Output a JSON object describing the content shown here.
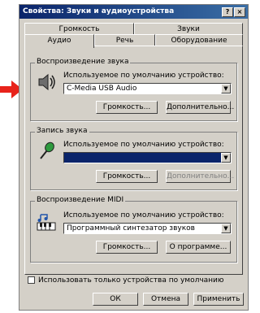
{
  "window": {
    "title": "Свойства: Звуки и аудиоустройства",
    "help_button": "?",
    "close_button": "×"
  },
  "tabs_row1": [
    {
      "label": "Громкость"
    },
    {
      "label": "Звуки"
    }
  ],
  "tabs_row2": [
    {
      "label": "Аудио"
    },
    {
      "label": "Речь"
    },
    {
      "label": "Оборудование"
    }
  ],
  "playback": {
    "title": "Воспроизведение звука",
    "device_label": "Используемое по умолчанию устройство:",
    "device_value": "C-Media USB Audio",
    "volume_button": "Громкость...",
    "advanced_button": "Дополнительно..."
  },
  "recording": {
    "title": "Запись звука",
    "device_label": "Используемое по умолчанию устройство:",
    "device_value": "",
    "volume_button": "Громкость...",
    "advanced_button": "Дополнительно..."
  },
  "midi": {
    "title": "Воспроизведение MIDI",
    "device_label": "Используемое по умолчанию устройство:",
    "device_value": "Программный синтезатор звуков",
    "volume_button": "Громкость...",
    "about_button": "О программе..."
  },
  "default_only_checkbox": {
    "label": "Использовать только устройства по умолчанию",
    "checked": false
  },
  "buttons": {
    "ok": "ОК",
    "cancel": "Отмена",
    "apply": "Применить"
  },
  "colors": {
    "title_bar": "#0a246a",
    "dialog_face": "#d4d0c8",
    "indicator_arrow": "#e8231b"
  }
}
